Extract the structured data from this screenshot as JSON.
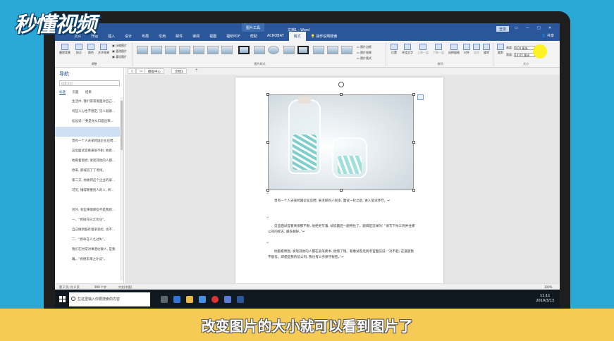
{
  "brand": {
    "logo_text": "秒懂视频"
  },
  "caption": "改变图片的大小就可以看到图片了",
  "window": {
    "doc_title": "文档1 - Word",
    "picture_tools": "图片工具",
    "login": "登录",
    "share": "共享",
    "controls": [
      "▭",
      "—",
      "□",
      "✕"
    ]
  },
  "ribbon_tabs": [
    "文件",
    "开始",
    "插入",
    "设计",
    "布局",
    "引用",
    "邮件",
    "审阅",
    "视图",
    "福昕PDF",
    "帮助",
    "ACROBAT",
    "格式"
  ],
  "active_tab": "格式",
  "tell_me": "操作说明搜索",
  "ribbon": {
    "adjust": {
      "label": "调整",
      "buttons": [
        "删除背景",
        "校正",
        "颜色",
        "艺术效果"
      ],
      "small": [
        "压缩图片",
        "更改图片",
        "重设图片"
      ]
    },
    "styles": {
      "label": "图片样式",
      "options": [
        "图片边框",
        "图片效果",
        "图片版式"
      ]
    },
    "arrange": {
      "label": "排列",
      "buttons": [
        "位置",
        "环绕文字",
        "上移一层",
        "下移一层",
        "选择窗格",
        "对齐",
        "组合",
        "旋转"
      ]
    },
    "size": {
      "label": "大小",
      "crop": "裁剪",
      "height_label": "高度:",
      "height_value": "9.04 厘米",
      "width_label": "宽度:",
      "width_value": "14.65 厘米"
    }
  },
  "nav": {
    "title": "导航",
    "search_placeholder": "搜索文档",
    "tabs": [
      "标题",
      "页面",
      "结果"
    ],
    "items": [
      "生活中, 我们常常要面对自己…",
      "有些人心性不稳定, 见人就跟…",
      "仙设说: “要是你从口面出来…",
      "",
      "曾有一个人去某跨国企业应聘…",
      "这位面试官看来很不耐, 他拒…",
      "他看着窗棂, 发现其他的人都…",
      "原来, 那城首丁丁考拐。",
      "第二天, 他收到这个企业的录…",
      "可见, 懂得尊重别人的人, 终…",
      "",
      "另外, 有些事情那些不是我想…",
      "一、“修短在已之功业”。",
      "自己做新酷有着拿劲栏, 也不…",
      "二、“修命在人之过失”。",
      "我们在时常对事谱达教人, 是我为…",
      "三、“修德未来之计议”。"
    ]
  },
  "doc_tabs": [
    "模板中心",
    "文档1"
  ],
  "doc": {
    "marks": [
      "↵",
      "↵",
      "↵"
    ],
    "paragraphs": [
      "曾有一个人去某跨国企业应聘, 来求职的人很多, 面试一轮之后, 进入笔试环节。↵",
      "这些面试官看来很那不耐, 他拒绝写着, 却说最后一题特往了。题目是这样的: “请写下你三到并往那公司的标志, 越多越好。”↵",
      "他看看周围, 发现其他的人都在奋笔疾书, 他愣了愣。看着试卷走到考官面前说: “对不起, 这道题我不能答。即使是我的前公司, 我也有义务保守秘密。”↵"
    ]
  },
  "status": {
    "page": "第 2 页, 共 4 页",
    "words": "999 个字",
    "lang": "中文(中国)",
    "zoom": "100%"
  },
  "taskbar": {
    "search": "在这里输入你要搜索的内容",
    "time": "11:11",
    "date": "2019/3/13"
  }
}
